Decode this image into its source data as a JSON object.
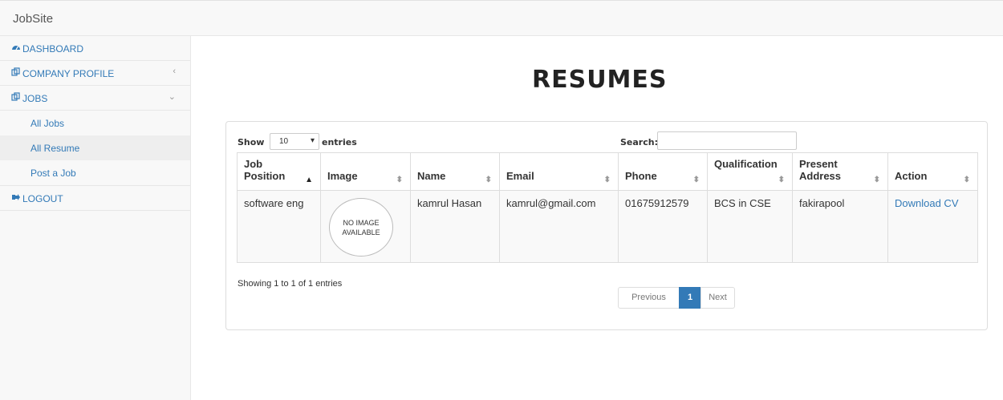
{
  "app": {
    "brand": "JobSite"
  },
  "sidebar": {
    "items": [
      {
        "label": "DASHBOARD",
        "icon": "dashboard-icon"
      },
      {
        "label": "COMPANY PROFILE",
        "icon": "copy-icon",
        "caret": "‹"
      },
      {
        "label": "JOBS",
        "icon": "copy-icon",
        "caret": "⌄"
      },
      {
        "label": "LOGOUT",
        "icon": "logout-icon"
      }
    ],
    "jobs_sub": [
      {
        "label": "All Jobs"
      },
      {
        "label": "All Resume",
        "active": true
      },
      {
        "label": "Post a Job"
      }
    ]
  },
  "main": {
    "title": "RESUMES"
  },
  "table_controls": {
    "show_label": "Show",
    "entries_value": "10",
    "entries_label": "entries",
    "search_label": "Search:",
    "search_value": ""
  },
  "table": {
    "columns": [
      {
        "line1": "Job",
        "line2": "Position"
      },
      {
        "line1": "",
        "line2": "Image"
      },
      {
        "line1": "",
        "line2": "Name"
      },
      {
        "line1": "",
        "line2": "Email"
      },
      {
        "line1": "",
        "line2": "Phone"
      },
      {
        "line1": "Qualification",
        "line2": ""
      },
      {
        "line1": "Present",
        "line2": "Address"
      },
      {
        "line1": "",
        "line2": "Action"
      }
    ],
    "rows": [
      {
        "position": "software eng",
        "image_text_1": "NO IMAGE",
        "image_text_2": "AVAILABLE",
        "name": "kamrul Hasan",
        "email": "kamrul@gmail.com",
        "phone": "01675912579",
        "qualification": "BCS in CSE",
        "address": "fakirapool",
        "action": "Download CV"
      }
    ]
  },
  "footer": {
    "info": "Showing 1 to 1 of 1 entries",
    "prev": "Previous",
    "page": "1",
    "next": "Next"
  },
  "colors": {
    "link": "#337ab7",
    "active_page": "#337ab7"
  }
}
